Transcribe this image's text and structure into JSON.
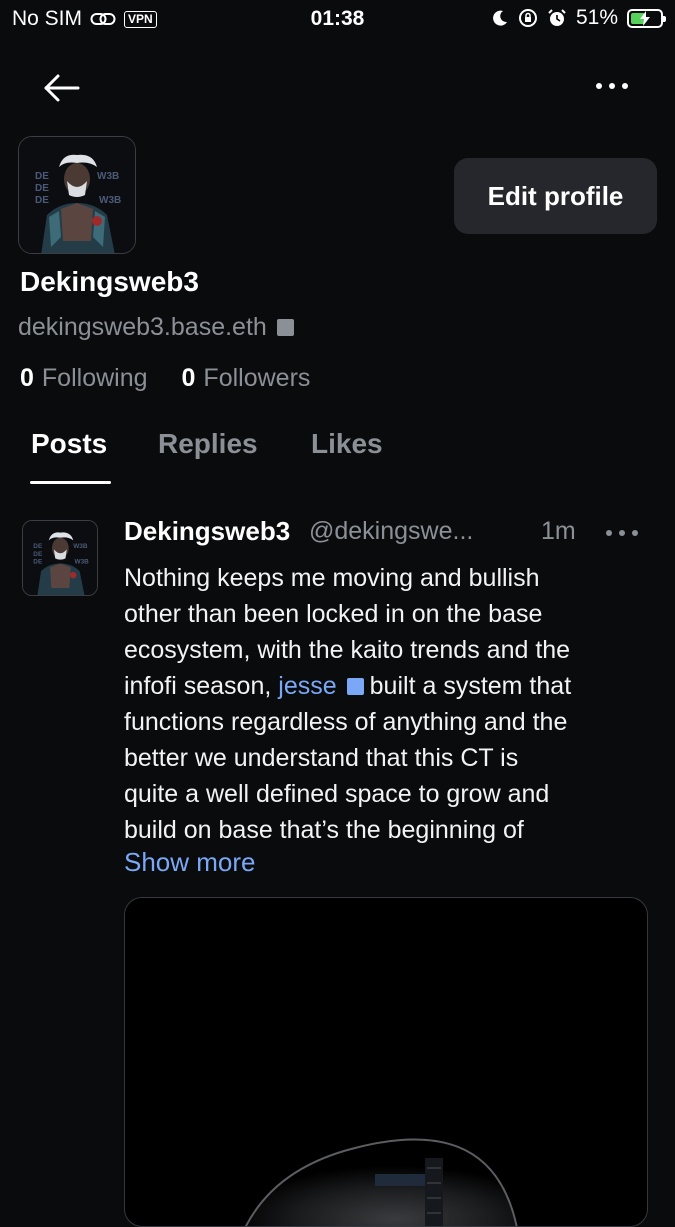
{
  "status_bar": {
    "carrier": "No SIM",
    "vpn": "VPN",
    "time": "01:38",
    "battery": "51%",
    "battery_level": 0.51
  },
  "nav": {
    "back_icon": "arrow-left-icon",
    "more_icon": "more-horizontal-icon"
  },
  "profile": {
    "avatar_text_lines": [
      "DE",
      "DE",
      "DE"
    ],
    "avatar_text_right": [
      "W3B",
      "W3B"
    ],
    "edit_label": "Edit profile",
    "display_name": "Dekingsweb3",
    "handle": "dekingsweb3.base.eth",
    "following_count": "0",
    "following_label": "Following",
    "followers_count": "0",
    "followers_label": "Followers"
  },
  "tabs": [
    {
      "label": "Posts",
      "active": true
    },
    {
      "label": "Replies",
      "active": false
    },
    {
      "label": "Likes",
      "active": false
    }
  ],
  "post": {
    "author": "Dekingsweb3",
    "handle": "@dekingswe...",
    "time": "1m",
    "lines": [
      "Nothing keeps me moving and bullish",
      "other than been locked in on the base",
      "ecosystem, with the kaito trends and the",
      "infofi season,",
      "jesse",
      "built a system that",
      "functions regardless of anything and the",
      "better we understand that this CT is",
      "quite a well defined space to grow and",
      "build on base that’s the beginning of"
    ],
    "show_more": "Show more"
  },
  "colors": {
    "background": "#0a0b0d",
    "muted": "#8b8f96",
    "link": "#7aa8f7",
    "button_bg": "#25272c",
    "battery_green": "#56d15a"
  }
}
